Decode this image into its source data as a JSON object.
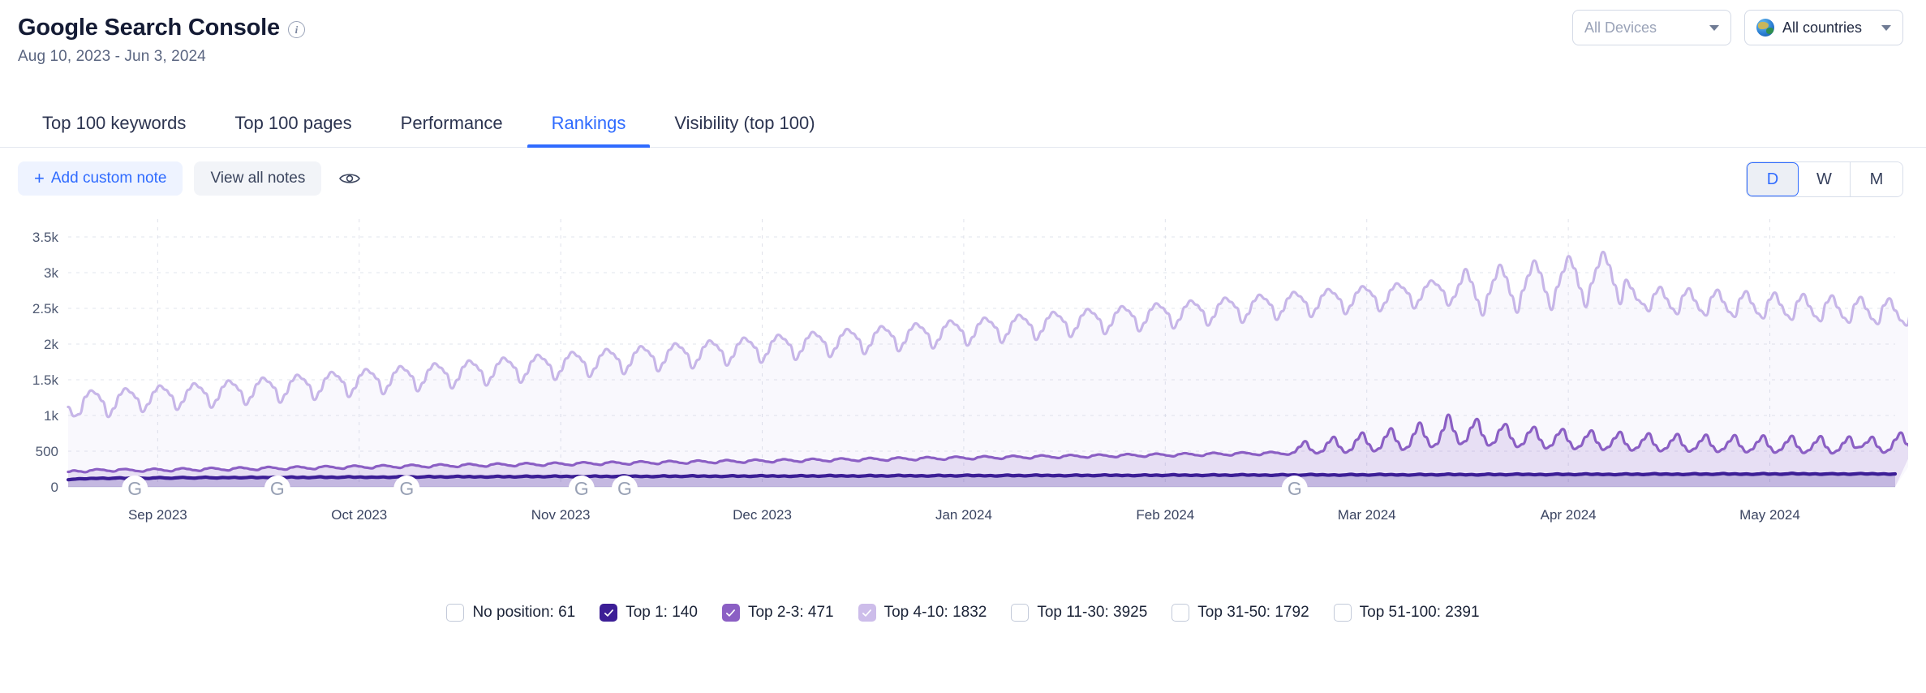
{
  "header": {
    "title": "Google Search Console",
    "info_icon": "info-icon",
    "date_range": "Aug 10, 2023 - Jun 3, 2024",
    "device_filter": {
      "value": "All Devices",
      "icon": "chevron-down-icon"
    },
    "country_filter": {
      "value": "All countries",
      "icon": "globe-icon",
      "caret": "chevron-down-icon"
    }
  },
  "tabs": [
    {
      "label": "Top 100 keywords",
      "active": false
    },
    {
      "label": "Top 100 pages",
      "active": false
    },
    {
      "label": "Performance",
      "active": false
    },
    {
      "label": "Rankings",
      "active": true
    },
    {
      "label": "Visibility (top 100)",
      "active": false
    }
  ],
  "toolbar": {
    "add_note_label": "Add custom note",
    "add_note_plus": "+",
    "view_notes_label": "View all notes",
    "eye_icon": "eye-icon",
    "periods": [
      {
        "label": "D",
        "active": true
      },
      {
        "label": "W",
        "active": false
      },
      {
        "label": "M",
        "active": false
      }
    ]
  },
  "colors": {
    "accent": "#2f6bff",
    "top1": "#3c1e96",
    "top2_3": "#8b5fc4",
    "top4_10": "#c7b6e8",
    "grid": "#d8dbe6",
    "text_dark": "#141b34",
    "text_muted": "#5a6580"
  },
  "legend": [
    {
      "label": "No position: 61",
      "checked": false,
      "color": "#ffffff"
    },
    {
      "label": "Top 1: 140",
      "checked": true,
      "color": "#3c1e96"
    },
    {
      "label": "Top 2-3: 471",
      "checked": true,
      "color": "#8b5fc4"
    },
    {
      "label": "Top 4-10: 1832",
      "checked": true,
      "color": "#cdbdea"
    },
    {
      "label": "Top 11-30: 3925",
      "checked": false,
      "color": "#ffffff"
    },
    {
      "label": "Top 31-50: 1792",
      "checked": false,
      "color": "#ffffff"
    },
    {
      "label": "Top 51-100: 2391",
      "checked": false,
      "color": "#ffffff"
    }
  ],
  "chart_data": {
    "type": "area",
    "title": "",
    "xlabel": "",
    "ylabel": "",
    "ylim": [
      0,
      3750
    ],
    "grid": true,
    "legend_position": "bottom",
    "y_ticks": [
      0,
      500,
      1000,
      1500,
      2000,
      2500,
      3000,
      3500
    ],
    "y_tick_labels": [
      "0",
      "500",
      "1k",
      "1.5k",
      "2k",
      "2.5k",
      "3k",
      "3.5k"
    ],
    "x_tick_labels": [
      "Sep 2023",
      "Oct 2023",
      "Nov 2023",
      "Dec 2023",
      "Jan 2024",
      "Feb 2024",
      "Mar 2024",
      "Apr 2024",
      "May 2024"
    ],
    "x_tick_positions": [
      0.073,
      0.148,
      0.222,
      0.297,
      0.371,
      0.446,
      0.521,
      0.595,
      0.67
    ],
    "annotations": [
      {
        "label": "G",
        "name": "google-update-marker",
        "x": 0.0365
      },
      {
        "label": "G",
        "name": "google-update-marker",
        "x": 0.1145
      },
      {
        "label": "G",
        "name": "google-update-marker",
        "x": 0.1853
      },
      {
        "label": "G",
        "name": "google-update-marker",
        "x": 0.281
      },
      {
        "label": "G",
        "name": "google-update-marker",
        "x": 0.3046
      },
      {
        "label": "G",
        "name": "google-update-marker",
        "x": 0.6713
      }
    ],
    "series": [
      {
        "name": "Top 1: 140",
        "color": "#3c1e96",
        "values": [
          100,
          108,
          115,
          112,
          120,
          118,
          124,
          116,
          122,
          128,
          118,
          124,
          130,
          122,
          118,
          126,
          132,
          124,
          120,
          128,
          134,
          126,
          122,
          130,
          136,
          128,
          124,
          132,
          128,
          134,
          126,
          130,
          138,
          128,
          134,
          130,
          136,
          128,
          132,
          140,
          130,
          136,
          128,
          134,
          142,
          132,
          138,
          130,
          136,
          144,
          134,
          140,
          132,
          138,
          134,
          140,
          132,
          138,
          146,
          136,
          142,
          134,
          140,
          148,
          138,
          144,
          136,
          142,
          150,
          140,
          146,
          138,
          144,
          136,
          142,
          150,
          140,
          146,
          138,
          144,
          152,
          142,
          148,
          140,
          146,
          154,
          144,
          150,
          142,
          148,
          140,
          146,
          154,
          144,
          150,
          142,
          148,
          156,
          146,
          152,
          144,
          150,
          142,
          148,
          156,
          146,
          152,
          144,
          150,
          158,
          148,
          154,
          146,
          152,
          144,
          150,
          158,
          148,
          154,
          146,
          152,
          160,
          150,
          156,
          148,
          154,
          146,
          152,
          160,
          150,
          156,
          148,
          154,
          162,
          152,
          158,
          150,
          156,
          148,
          154,
          162,
          152,
          158,
          150,
          156,
          164,
          154,
          160,
          152,
          158,
          150,
          156,
          164,
          154,
          160,
          152,
          158,
          166,
          156,
          162,
          154,
          160,
          152,
          158,
          166,
          156,
          162,
          154,
          160,
          168,
          158,
          164,
          156,
          162,
          154,
          160,
          168,
          158,
          164,
          156,
          162,
          170,
          160,
          166,
          158,
          164,
          156,
          162,
          170,
          160,
          166,
          158,
          164,
          172,
          162,
          168,
          160,
          166,
          158,
          164,
          172,
          162,
          168,
          160,
          166,
          174,
          164,
          170,
          162,
          168,
          160,
          166,
          174,
          164,
          170,
          162,
          168,
          176,
          166,
          172,
          164,
          170,
          162,
          168,
          176,
          166,
          172,
          164,
          170,
          178,
          168,
          174,
          166,
          172,
          164,
          170,
          178,
          168,
          174,
          166,
          172,
          180,
          170,
          176,
          168,
          174,
          166,
          172,
          180,
          170,
          176,
          168,
          174,
          182,
          172,
          178,
          170,
          176,
          168,
          174,
          182,
          172,
          178,
          170,
          176,
          184,
          174,
          180,
          172,
          178,
          170,
          176,
          184,
          174,
          180,
          172,
          178,
          186,
          176,
          182,
          174,
          180,
          172,
          178,
          186,
          176,
          182,
          174,
          180,
          188,
          178,
          184,
          176,
          182,
          174,
          180,
          188,
          178,
          184,
          176,
          182,
          190,
          180,
          186,
          178,
          184,
          176,
          182,
          186,
          178,
          184,
          176,
          182,
          188,
          180,
          186,
          178,
          184,
          176,
          182
        ]
      },
      {
        "name": "Top 2-3: 471",
        "color": "#8b5fc4",
        "values": [
          210,
          230,
          218,
          205,
          232,
          248,
          240,
          225,
          215,
          245,
          250,
          238,
          222,
          214,
          240,
          256,
          244,
          228,
          218,
          248,
          262,
          250,
          234,
          224,
          254,
          268,
          256,
          240,
          230,
          260,
          274,
          262,
          246,
          236,
          266,
          280,
          268,
          252,
          242,
          272,
          286,
          274,
          258,
          248,
          278,
          292,
          280,
          264,
          254,
          284,
          298,
          286,
          270,
          260,
          290,
          304,
          292,
          276,
          266,
          296,
          310,
          298,
          282,
          272,
          302,
          316,
          304,
          288,
          278,
          308,
          322,
          310,
          294,
          284,
          314,
          328,
          316,
          300,
          290,
          320,
          334,
          322,
          306,
          296,
          326,
          340,
          328,
          312,
          302,
          332,
          346,
          334,
          318,
          308,
          338,
          352,
          340,
          324,
          314,
          344,
          358,
          346,
          330,
          320,
          350,
          364,
          352,
          336,
          326,
          356,
          370,
          358,
          342,
          332,
          362,
          376,
          364,
          348,
          338,
          368,
          382,
          370,
          354,
          344,
          374,
          388,
          376,
          360,
          350,
          380,
          394,
          382,
          366,
          356,
          386,
          400,
          388,
          372,
          362,
          392,
          406,
          394,
          378,
          368,
          398,
          412,
          400,
          384,
          374,
          404,
          418,
          406,
          390,
          380,
          410,
          424,
          412,
          396,
          386,
          416,
          430,
          418,
          402,
          392,
          422,
          436,
          424,
          408,
          398,
          428,
          442,
          430,
          414,
          404,
          434,
          448,
          436,
          420,
          410,
          440,
          454,
          442,
          426,
          416,
          446,
          460,
          448,
          432,
          422,
          452,
          466,
          454,
          438,
          428,
          458,
          472,
          460,
          444,
          434,
          464,
          478,
          466,
          450,
          440,
          470,
          484,
          472,
          456,
          446,
          476,
          490,
          478,
          462,
          452,
          482,
          560,
          640,
          520,
          470,
          500,
          620,
          700,
          560,
          480,
          520,
          660,
          760,
          600,
          500,
          540,
          700,
          820,
          640,
          520,
          560,
          740,
          900,
          700,
          560,
          600,
          790,
          1010,
          780,
          600,
          640,
          830,
          950,
          720,
          580,
          620,
          800,
          880,
          680,
          560,
          600,
          760,
          840,
          660,
          540,
          580,
          730,
          810,
          640,
          530,
          570,
          700,
          790,
          620,
          520,
          560,
          680,
          770,
          600,
          510,
          550,
          660,
          750,
          590,
          500,
          540,
          650,
          740,
          580,
          495,
          535,
          640,
          730,
          575,
          490,
          530,
          635,
          725,
          570,
          485,
          525,
          630,
          720,
          565,
          480,
          520,
          625,
          715,
          560,
          475,
          515,
          620,
          710,
          555,
          470,
          510,
          615,
          705,
          550,
          560,
          620,
          700,
          560,
          480,
          520,
          660,
          760,
          600,
          520
        ]
      },
      {
        "name": "Top 4-10: 1832",
        "color": "#c7b6e8",
        "values": [
          1120,
          990,
          1020,
          1260,
          1350,
          1300,
          1200,
          980,
          1100,
          1290,
          1380,
          1320,
          1240,
          1050,
          1160,
          1330,
          1420,
          1360,
          1280,
          1080,
          1190,
          1360,
          1450,
          1390,
          1310,
          1110,
          1220,
          1400,
          1490,
          1430,
          1350,
          1150,
          1260,
          1440,
          1530,
          1470,
          1390,
          1180,
          1300,
          1480,
          1570,
          1510,
          1430,
          1220,
          1340,
          1520,
          1610,
          1550,
          1470,
          1260,
          1380,
          1560,
          1650,
          1590,
          1510,
          1300,
          1420,
          1600,
          1690,
          1630,
          1550,
          1340,
          1460,
          1640,
          1730,
          1670,
          1590,
          1380,
          1500,
          1680,
          1770,
          1710,
          1630,
          1420,
          1540,
          1720,
          1810,
          1750,
          1670,
          1460,
          1580,
          1760,
          1850,
          1790,
          1710,
          1500,
          1620,
          1800,
          1890,
          1830,
          1750,
          1540,
          1660,
          1840,
          1930,
          1870,
          1790,
          1580,
          1700,
          1880,
          1970,
          1910,
          1830,
          1620,
          1740,
          1920,
          2010,
          1950,
          1870,
          1660,
          1780,
          1960,
          2050,
          1990,
          1910,
          1700,
          1820,
          2000,
          2090,
          2030,
          1950,
          1740,
          1860,
          2040,
          2130,
          2070,
          1990,
          1780,
          1900,
          2080,
          2170,
          2110,
          2030,
          1820,
          1940,
          2120,
          2210,
          2150,
          2070,
          1860,
          1980,
          2160,
          2250,
          2190,
          2110,
          1900,
          2020,
          2200,
          2290,
          2230,
          2150,
          1940,
          2060,
          2240,
          2330,
          2270,
          2190,
          1980,
          2100,
          2280,
          2370,
          2310,
          2230,
          2020,
          2140,
          2320,
          2410,
          2350,
          2270,
          2060,
          2180,
          2360,
          2450,
          2390,
          2310,
          2100,
          2220,
          2400,
          2490,
          2430,
          2350,
          2140,
          2260,
          2440,
          2530,
          2470,
          2390,
          2180,
          2300,
          2480,
          2570,
          2510,
          2430,
          2220,
          2340,
          2520,
          2610,
          2550,
          2470,
          2260,
          2380,
          2560,
          2650,
          2590,
          2510,
          2300,
          2420,
          2600,
          2690,
          2630,
          2550,
          2340,
          2460,
          2640,
          2730,
          2670,
          2590,
          2380,
          2500,
          2680,
          2770,
          2710,
          2630,
          2420,
          2540,
          2720,
          2810,
          2750,
          2670,
          2460,
          2580,
          2760,
          2850,
          2790,
          2710,
          2500,
          2620,
          2800,
          2890,
          2830,
          2750,
          2540,
          2660,
          2840,
          3050,
          2870,
          2620,
          2400,
          2700,
          2900,
          3110,
          2940,
          2680,
          2440,
          2750,
          2960,
          3170,
          3000,
          2730,
          2480,
          2800,
          3010,
          3230,
          3060,
          2780,
          2520,
          2850,
          3070,
          3290,
          3110,
          2830,
          2560,
          2900,
          2780,
          2620,
          2560,
          2460,
          2700,
          2800,
          2640,
          2500,
          2420,
          2680,
          2780,
          2610,
          2470,
          2400,
          2660,
          2760,
          2590,
          2450,
          2380,
          2640,
          2740,
          2570,
          2430,
          2360,
          2620,
          2720,
          2550,
          2410,
          2340,
          2600,
          2700,
          2530,
          2390,
          2320,
          2580,
          2680,
          2510,
          2370,
          2300,
          2560,
          2660,
          2490,
          2350,
          2280,
          2540,
          2640,
          2470,
          2330,
          2260,
          2520,
          2620,
          2450,
          2540,
          2600,
          2480,
          2420,
          2560,
          2620,
          2480,
          2400,
          2560,
          2640,
          2480,
          2560,
          2620,
          2520,
          2480,
          2560
        ]
      }
    ]
  }
}
